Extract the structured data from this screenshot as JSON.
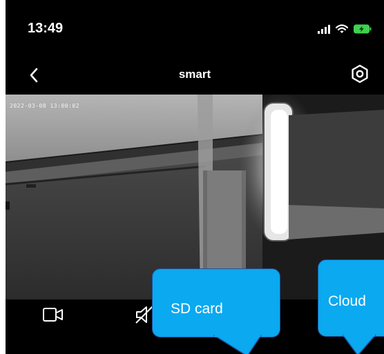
{
  "status_bar": {
    "time": "13:49",
    "icons": [
      "signal-icon",
      "wifi-icon",
      "battery-charging-icon"
    ]
  },
  "nav": {
    "title": "smart",
    "back_icon": "chevron-left-icon",
    "settings_icon": "settings-hexagon-icon"
  },
  "video": {
    "timestamp": "2022-03-08 13:00:02"
  },
  "toolbar": {
    "icons": [
      "video-record-icon",
      "speaker-mute-icon"
    ]
  },
  "callouts": {
    "sd_card": "SD card",
    "cloud": "Cloud"
  },
  "colors": {
    "background": "#000000",
    "callout_fill": "#0aa9f0",
    "callout_border": "#22509a",
    "text": "#ffffff"
  }
}
